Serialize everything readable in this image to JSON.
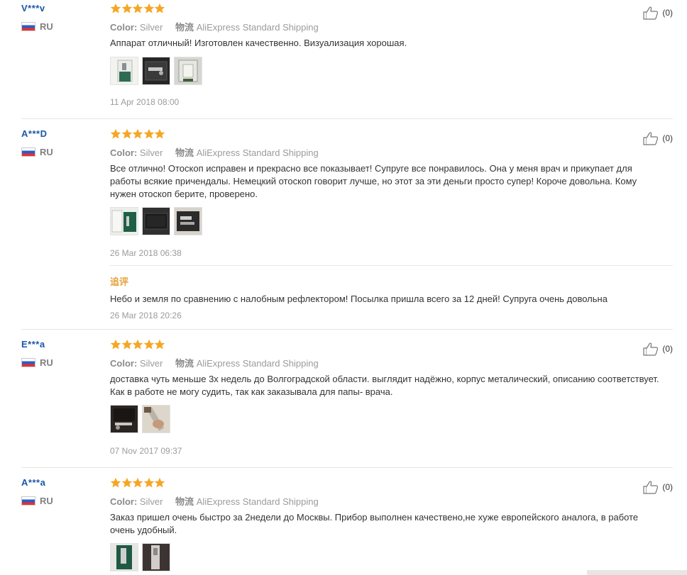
{
  "labels": {
    "color": "Color:",
    "shipping": "物流",
    "followup": "追评"
  },
  "reviews": [
    {
      "user": "V***v",
      "country": "RU",
      "rating": 5,
      "color": "Silver",
      "shipping": "AliExpress Standard Shipping",
      "text": "Аппарат отличный! Изготовлен качественно. Визуализация хорошая.",
      "photo_count": 3,
      "date": "11 Apr 2018 08:00",
      "helpful": "(0)"
    },
    {
      "user": "A***D",
      "country": "RU",
      "rating": 5,
      "color": "Silver",
      "shipping": "AliExpress Standard Shipping",
      "text": "Все отлично! Отоскоп исправен и прекрасно все показывает! Супруге все понравилось. Она у меня врач и прикупает для работы всякие причендалы. Немецкий отоскоп говорит лучше, но этот за эти деньги просто супер! Короче довольна. Кому нужен отоскоп берите, проверено.",
      "photo_count": 3,
      "date": "26 Mar 2018 06:38",
      "helpful": "(0)",
      "followup": {
        "text": "Небо и земля по сравнению с налобным рефлектором! Посылка пришла всего за 12 дней! Супруга очень довольна",
        "date": "26 Mar 2018 20:26"
      }
    },
    {
      "user": "E***a",
      "country": "RU",
      "rating": 5,
      "color": "Silver",
      "shipping": "AliExpress Standard Shipping",
      "text": "доставка чуть меньше 3х недель до Волгоградской области. выглядит надёжно, корпус металический, описанию соответствует. Как в работе не могу судить, так как заказывала для папы- врача.",
      "photo_count": 2,
      "date": "07 Nov 2017 09:37",
      "helpful": "(0)"
    },
    {
      "user": "A***a",
      "country": "RU",
      "rating": 5,
      "color": "Silver",
      "shipping": "AliExpress Standard Shipping",
      "text": "Заказ пришел очень быстро за 2недели до Москвы. Прибор выполнен качествено,не хуже европейского аналога, в работе очень удобный.",
      "photo_count": 2,
      "helpful": "(0)"
    }
  ],
  "colors": {
    "user_name": "#1b57a8",
    "star": "#f5a623",
    "followup": "#e6a23c",
    "divider": "#e5e5e5"
  }
}
